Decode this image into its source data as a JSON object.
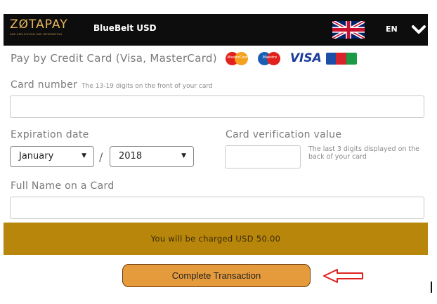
{
  "header": {
    "logo_text": "ZØTAPAY",
    "logo_tagline": "ONE APPLICATION ONE INTEGRATION",
    "merchant_label": "BlueBelt USD",
    "language": "EN",
    "flag_icon": "uk-flag-icon",
    "dropdown_icon": "chevron-down-icon"
  },
  "payment": {
    "title": "Pay by Credit Card (Visa, MasterCard)",
    "brand_logos": [
      {
        "name": "mastercard",
        "text": "MasterCard"
      },
      {
        "name": "maestro",
        "text": "Maestro"
      },
      {
        "name": "visa",
        "text": "VISA"
      },
      {
        "name": "jcb",
        "text": ""
      }
    ]
  },
  "form": {
    "card_number_label": "Card number",
    "card_number_hint": "The 13-19 digits on the front of your card",
    "card_number_value": "",
    "expiration_label": "Expiration date",
    "expiry_month": "January",
    "expiry_separator": "/",
    "expiry_year": "2018",
    "cvv_label": "Card verification value",
    "cvv_value": "",
    "cvv_hint": "The last 3 digits displayed on the back of your card",
    "name_label": "Full Name on a Card",
    "name_value": ""
  },
  "charge": {
    "text": "You will be charged USD 50.00"
  },
  "actions": {
    "complete_label": "Complete Transaction"
  },
  "colors": {
    "header_bg": "#0d0d0d",
    "logo_gold": "#e7b75d",
    "charge_bar": "#b8860b",
    "button_bg": "#e59a3c",
    "arrow_red": "#e02020"
  }
}
